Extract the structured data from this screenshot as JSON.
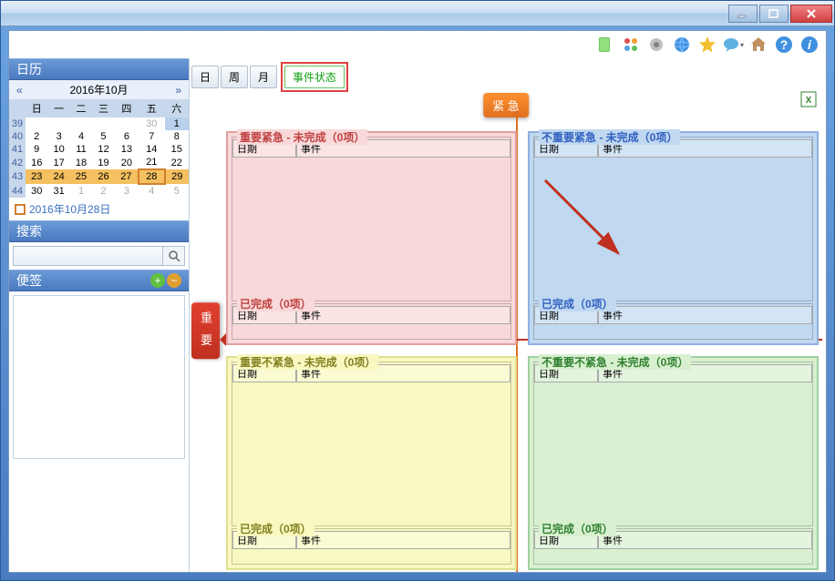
{
  "window": {
    "title": ""
  },
  "toolbar_icons": [
    "book",
    "apps",
    "gear",
    "globe",
    "star",
    "chat",
    "home",
    "help",
    "info"
  ],
  "sidebar": {
    "calendar_title": "日历",
    "month_label": "2016年10月",
    "prev": "«",
    "next": "»",
    "weekdays": [
      "",
      "日",
      "一",
      "二",
      "三",
      "四",
      "五",
      "六"
    ],
    "weeks": [
      {
        "wn": "39",
        "days": [
          "",
          "",
          "",
          "",
          "",
          "30",
          "1"
        ],
        "dim": [
          0,
          0,
          0,
          0,
          0,
          1,
          0
        ]
      },
      {
        "wn": "40",
        "days": [
          "2",
          "3",
          "4",
          "5",
          "6",
          "7",
          "8"
        ]
      },
      {
        "wn": "41",
        "days": [
          "9",
          "10",
          "11",
          "12",
          "13",
          "14",
          "15"
        ]
      },
      {
        "wn": "42",
        "days": [
          "16",
          "17",
          "18",
          "19",
          "20",
          "21",
          "22"
        ]
      },
      {
        "wn": "43",
        "days": [
          "23",
          "24",
          "25",
          "26",
          "27",
          "28",
          "29"
        ],
        "sel": true,
        "today": 5
      },
      {
        "wn": "44",
        "days": [
          "30",
          "31",
          "1",
          "2",
          "3",
          "4",
          "5"
        ],
        "dim": [
          0,
          0,
          1,
          1,
          1,
          1,
          1
        ]
      }
    ],
    "today_label": "2016年10月28日",
    "search_title": "搜索",
    "search_placeholder": "",
    "notes_title": "便签"
  },
  "tabs": {
    "day": "日",
    "week": "周",
    "month": "月",
    "status": "事件状态"
  },
  "axis": {
    "urgent": "紧 急",
    "important": "重 要"
  },
  "columns": {
    "date": "日期",
    "event": "事件"
  },
  "quads": {
    "q1": {
      "t1": "重要紧急 - 未完成（0项）",
      "t2": "已完成（0项）"
    },
    "q2": {
      "t1": "不重要紧急 - 未完成（0项）",
      "t2": "已完成（0项）"
    },
    "q3": {
      "t1": "重要不紧急 - 未完成（0项）",
      "t2": "已完成（0项）"
    },
    "q4": {
      "t1": "不重要不紧急 - 未完成（0项）",
      "t2": "已完成（0项）"
    }
  }
}
